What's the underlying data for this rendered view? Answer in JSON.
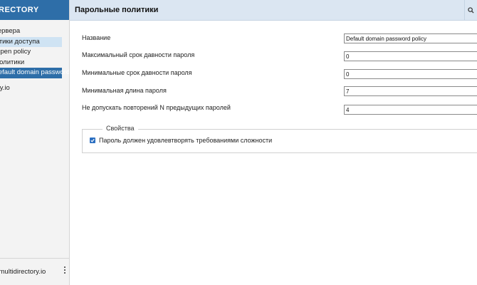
{
  "sidebar": {
    "header": "DIRECTORY",
    "items": [
      {
        "label": "Сервера"
      },
      {
        "label": "Политики доступа"
      },
      {
        "label": "Open policy"
      },
      {
        "label": "Парольные политики"
      },
      {
        "label": "Default domain password policy"
      }
    ],
    "domain": "multidirectory.io",
    "footer": "admin@multidirectory.io"
  },
  "header": {
    "title": "Парольные политики",
    "search_icon": "search-icon"
  },
  "form": {
    "fields": [
      {
        "label": "Название",
        "value": "Default domain password policy"
      },
      {
        "label": "Максимальный срок давности пароля",
        "value": "0"
      },
      {
        "label": "Минимальные срок давности пароля",
        "value": "0"
      },
      {
        "label": "Минимальная длина пароля",
        "value": "7"
      },
      {
        "label": "Не допускать повторений N предыдущих паролей",
        "value": "4"
      }
    ],
    "properties": {
      "legend": "Свойства",
      "checkbox_label": "Пароль должен удовлевтворять требованиями сложности",
      "checked": true
    }
  },
  "colors": {
    "accent": "#2e6ea8",
    "topbar": "#dbe6f2",
    "selected_light": "#cfe3f3",
    "checkbox": "#2b6fc1"
  }
}
